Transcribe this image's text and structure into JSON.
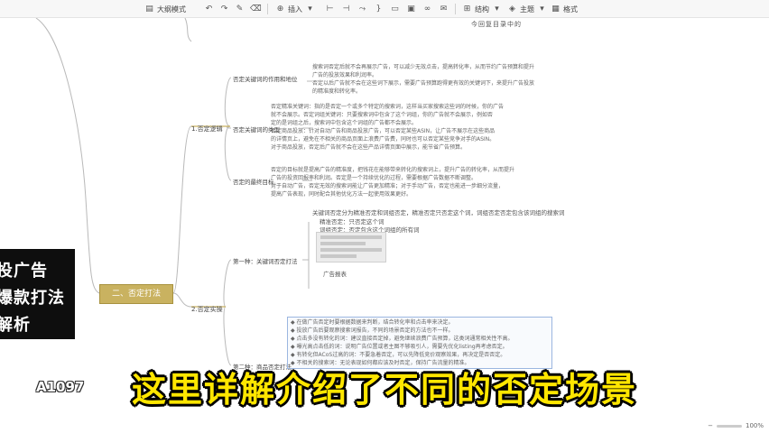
{
  "toolbar": {
    "outline_mode": "大纲模式",
    "insert": "插入",
    "structure": "结构",
    "theme": "主题",
    "style": "格式",
    "hint": "今回复目录中的"
  },
  "mindmap": {
    "central": "二、否定打法",
    "branches": [
      {
        "label": "1.否定逻辑",
        "children": [
          {
            "label": "否定关键词的作用和地位",
            "note": "搜索词否定后就不会再展示广告，可以减少无效点击，提高转化率，从而节约广告预算和提升\n广告的投放效果和利润率。\n否定以后广告就不会在这些词下展示，需要广告预算跑得更有效的关键词下，来提升广告投放\n的精准度和转化率。"
          },
          {
            "label": "否定关键词的类型",
            "note": "否定精准关键词：指的是否定一个或多个特定的搜索词，这样当买家搜索这些词的时候，你的广告\n就不会展示。否定词组关键词：只要搜索词中包含了这个词组，你的广告就不会展示，例如否\n定的是词组之后，搜索词中包含这个词组的广告都不会展示。\n否定商品投放：针对自动广告和商品投放广告，可以否定某些ASIN，让广告不展示在这些商品\n的详情页上，避免在不相关的商品页面上浪费广告费，同时也可以否定某些竞争对手的ASIN。\n对于商品投放，否定后广告就不会在这些产品详情页面中展示，能节省广告预算。"
          },
          {
            "label": "否定的最终目标",
            "note": "否定的目标就是提高广告的精准度，把钱花在能够带来转化的搜索词上，提升广告的转化率，从而提升\n广告的投资回报率和利润。否定是一个持续优化的过程，需要根据广告数据不断调整。\n对于自动广告，否定无效的搜索词能让广告更加精准；对于手动广告，否定也能进一步细分流量，\n提高广告表现，同时配合其他优化方法一起使用效果更好。"
          }
        ]
      },
      {
        "label": "2.否定实操",
        "children": [
          {
            "label": "第一种：关键词否定打法",
            "bullets": [
              "关键词否定分为精准否定和词组否定，精准否定只否定这个词，词组否定否定包含该词组的搜索词",
              "精准否定：只否定这个词",
              "词组否定：否定包含这个词组的所有词"
            ],
            "tag": "广告报表"
          },
          {
            "label": "第二种：商品否定打法",
            "note": "◆ 在做广告否定时要根据数据来判断，结合转化率和点击率来决定。\n◆ 投放广告后要观察搜索词报告，不同的场景否定的方法也不一样。\n◆ 点击多没有转化的词：建议直接否定掉，避免继续浪费广告预算，这类词通常相关性不高。\n◆ 曝光高点击低的词：说明广告位置或者主图不够吸引人，需要先优化listing再考虑否定。\n◆ 有转化但ACoS过高的词：不要急着否定，可以先降低竞价观察效果，再决定是否否定。\n◆ 不相关的搜索词：无论表现如何都应该及时否定，保持广告流量的精准。"
          }
        ]
      }
    ]
  },
  "overlay": {
    "side_lines": [
      "投广告",
      "爆款打法",
      "解析"
    ],
    "watermark": "A1097",
    "subtitle": "这里详解介绍了不同的否定场景"
  },
  "status": {
    "zoom": "100%"
  }
}
